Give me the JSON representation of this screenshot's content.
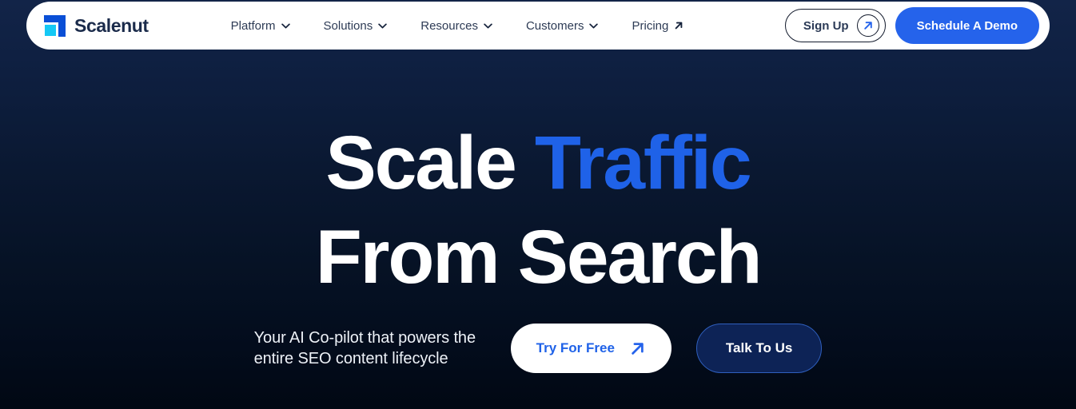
{
  "brand": {
    "name": "Scalenut",
    "logo_icon": "scalenut-flag-logo-icon",
    "logo_dark_color": "#0a4fd6",
    "logo_accent_color": "#14c8f5"
  },
  "colors": {
    "page_background_top": "#122448",
    "page_background_bottom": "#010813",
    "accent_blue": "#1f62e8",
    "button_blue": "#2563eb",
    "nav_text": "#2d3b55",
    "headline_white": "#ffffff"
  },
  "navbar": {
    "links": [
      {
        "label": "Platform",
        "indicator": "chevron-down-icon"
      },
      {
        "label": "Solutions",
        "indicator": "chevron-down-icon"
      },
      {
        "label": "Resources",
        "indicator": "chevron-down-icon"
      },
      {
        "label": "Customers",
        "indicator": "chevron-down-icon"
      },
      {
        "label": "Pricing",
        "indicator": "arrow-up-right-icon"
      }
    ],
    "sign_up": {
      "label": "Sign Up",
      "icon": "arrow-up-right-icon"
    },
    "schedule_demo": {
      "label": "Schedule A Demo"
    }
  },
  "hero": {
    "headline": {
      "line1_plain": "Scale ",
      "line1_accent": "Traffic",
      "line2": "From Search"
    },
    "subtitle": "Your AI Co-pilot that powers the entire SEO content lifecycle",
    "primary_cta": {
      "label": "Try For Free",
      "icon": "arrow-up-right-icon"
    },
    "secondary_cta": {
      "label": "Talk To Us"
    }
  }
}
